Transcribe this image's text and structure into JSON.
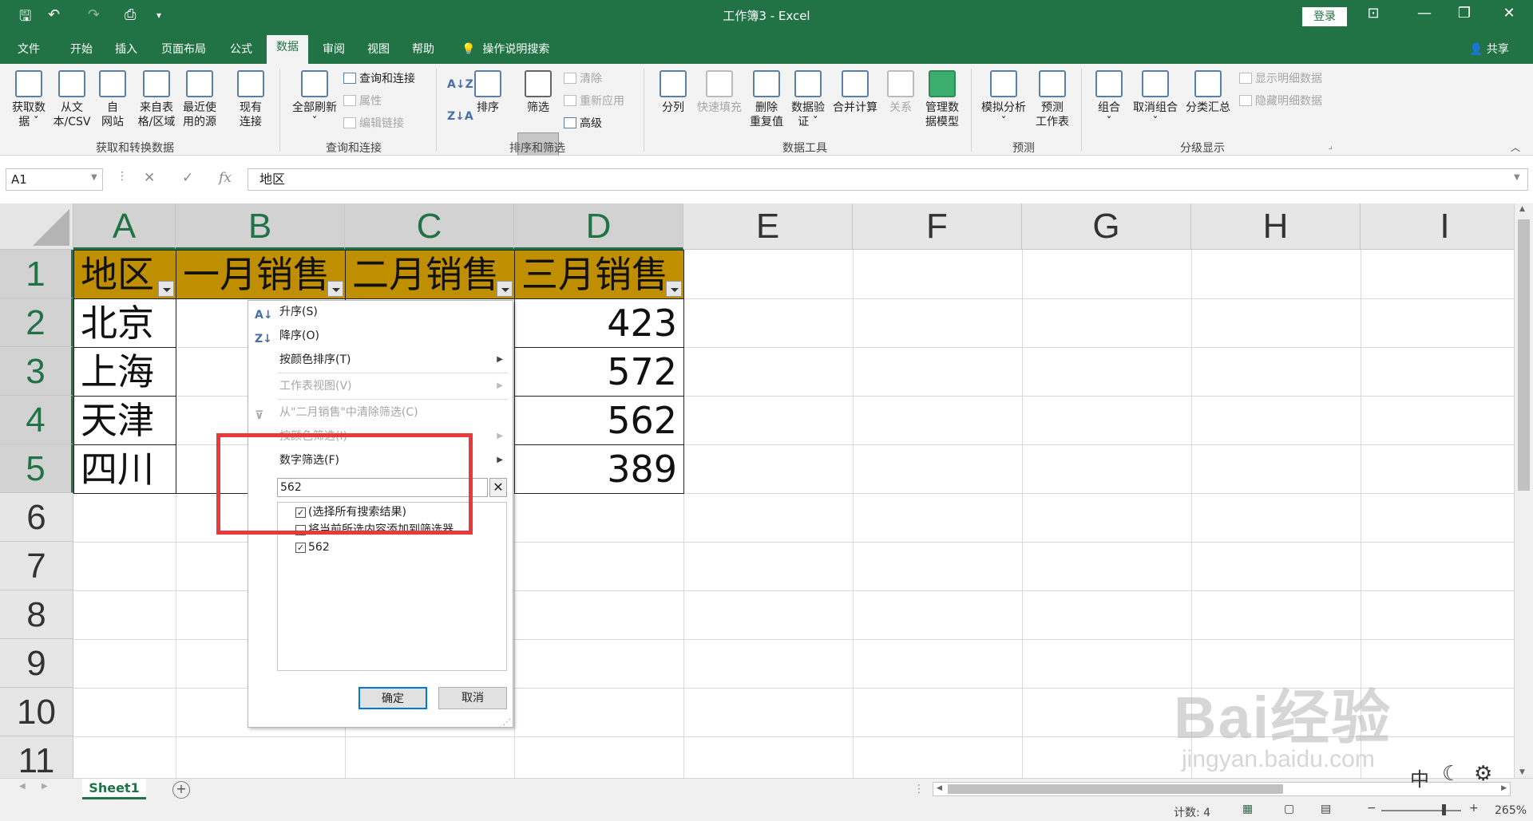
{
  "window": {
    "title": "工作簿3  -  Excel",
    "login": "登录"
  },
  "tabs": [
    {
      "label": "文件"
    },
    {
      "label": "开始"
    },
    {
      "label": "插入"
    },
    {
      "label": "页面布局"
    },
    {
      "label": "公式"
    },
    {
      "label": "数据"
    },
    {
      "label": "审阅"
    },
    {
      "label": "视图"
    },
    {
      "label": "帮助"
    }
  ],
  "tell_me": "操作说明搜索",
  "share": "共享",
  "ribbon": {
    "get_data": "获取数\n据 ˇ",
    "from_csv": "从文\n本/CSV",
    "from_web": "自\n网站",
    "from_table": "来自表\n格/区域",
    "recent_sources": "最近使\n用的源",
    "existing_conn": "现有\n连接",
    "group_get": "获取和转换数据",
    "refresh_all": "全部刷新\nˇ",
    "queries_conn": "查询和连接",
    "properties": "属性",
    "edit_links": "编辑链接",
    "group_query": "查询和连接",
    "sort": "排序",
    "filter": "筛选",
    "clear": "清除",
    "reapply": "重新应用",
    "advanced": "高级",
    "group_sort": "排序和筛选",
    "text_to_col": "分列",
    "flash_fill": "快速填充",
    "remove_dup": "删除\n重复值",
    "data_valid": "数据验\n证 ˇ",
    "consolidate": "合并计算",
    "relations": "关系",
    "data_model": "管理数\n据模型",
    "group_tools": "数据工具",
    "what_if": "模拟分析\nˇ",
    "forecast": "预测\n工作表",
    "group_forecast": "预测",
    "group": "组合\nˇ",
    "ungroup": "取消组合\nˇ",
    "subtotal": "分类汇总",
    "show_detail": "显示明细数据",
    "hide_detail": "隐藏明细数据",
    "group_outline": "分级显示"
  },
  "formula_bar": {
    "namebox": "A1",
    "formula": "地区",
    "fx": "fx"
  },
  "columns": [
    "A",
    "B",
    "C",
    "D",
    "E",
    "F",
    "G",
    "H",
    "I"
  ],
  "rows": [
    "1",
    "2",
    "3",
    "4",
    "5",
    "6",
    "7",
    "8",
    "9",
    "10",
    "11"
  ],
  "cells": {
    "header": [
      "地区",
      "一月销售",
      "二月销售",
      "三月销售"
    ],
    "regions": [
      "北京",
      "上海",
      "天津",
      "四川"
    ],
    "march": [
      "423",
      "572",
      "562",
      "389"
    ]
  },
  "dropdown": {
    "sort_asc": "升序(S)",
    "sort_desc": "降序(O)",
    "sort_color": "按颜色排序(T)",
    "sheet_view": "工作表视图(V)",
    "clear_filter": "从\"二月销售\"中清除筛选(C)",
    "color_filter": "按颜色筛选(I)",
    "number_filter": "数字筛选(F)",
    "search_value": "562",
    "select_all": "(选择所有搜索结果)",
    "add_current": "将当前所选内容添加到筛选器",
    "item_562": "562",
    "ok": "确定",
    "cancel": "取消"
  },
  "sheets": [
    {
      "name": "Sheet1"
    }
  ],
  "status": {
    "count": "计数: 4",
    "zoom": "265%"
  },
  "watermark": {
    "brand": "Bai经验",
    "url": "jingyan.baidu.com"
  }
}
